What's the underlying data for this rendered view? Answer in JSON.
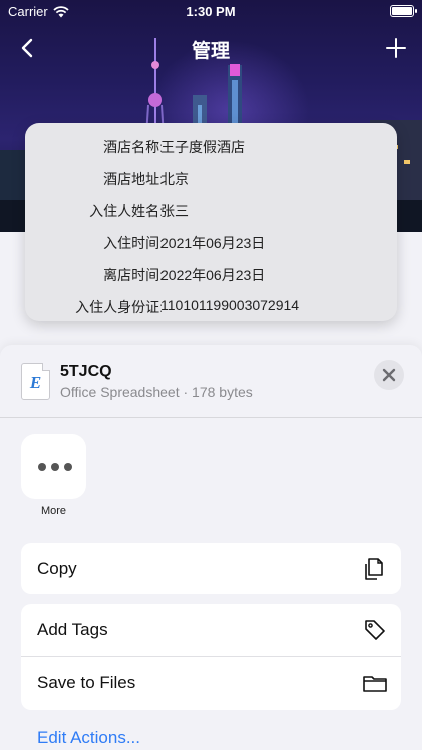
{
  "status_bar": {
    "carrier": "Carrier",
    "time": "1:30 PM"
  },
  "nav": {
    "title": "管理"
  },
  "hotel_info": {
    "rows": [
      {
        "label": "酒店名称:",
        "value": "王子度假酒店"
      },
      {
        "label": "酒店地址:",
        "value": "北京"
      },
      {
        "label": "入住人姓名:",
        "value": "张三"
      },
      {
        "label": "入住时间:",
        "value": "2021年06月23日"
      },
      {
        "label": "离店时间:",
        "value": "2022年06月23日"
      },
      {
        "label": "入住人身份证:",
        "value": "110101199003072914"
      }
    ]
  },
  "share_sheet": {
    "file_name": "5TJCQ",
    "file_meta": "Office Spreadsheet · 178 bytes",
    "file_icon_letter": "E",
    "more_label": "More",
    "actions": [
      {
        "label": "Copy",
        "icon": "copy-icon"
      },
      {
        "label": "Add Tags",
        "icon": "tag-icon"
      },
      {
        "label": "Save to Files",
        "icon": "folder-icon"
      }
    ],
    "edit_actions_label": "Edit Actions...",
    "accent_color": "#2f7cf6"
  }
}
